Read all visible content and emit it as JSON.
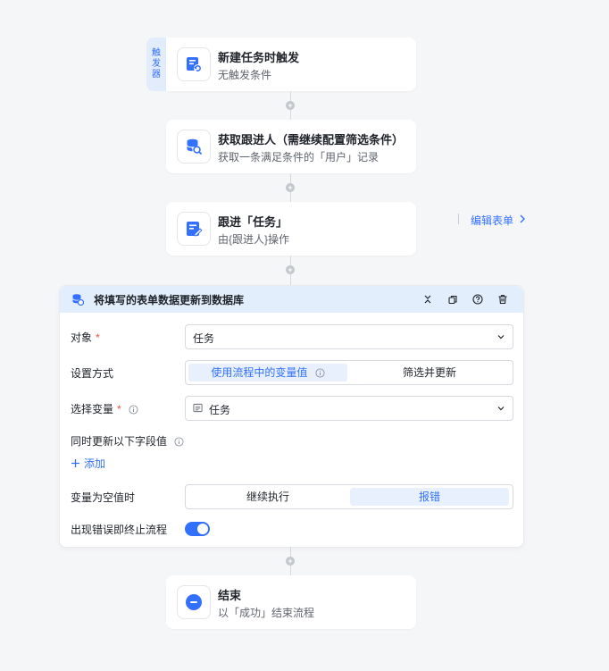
{
  "trigger_tab": [
    "触",
    "发",
    "器"
  ],
  "nodes": {
    "trigger": {
      "title": "新建任务时触发",
      "subtitle": "无触发条件"
    },
    "get_follower": {
      "title": "获取跟进人（需继续配置筛选条件）",
      "subtitle": "获取一条满足条件的「用户」记录"
    },
    "follow_task": {
      "title": "跟进「任务」",
      "subtitle": "由{跟进人}操作",
      "link": "编辑表单"
    },
    "end": {
      "title": "结束",
      "subtitle": "以「成功」结束流程"
    }
  },
  "panel": {
    "title": "将填写的表单数据更新到数据库",
    "header_icons": [
      "collapse-icon",
      "copy-icon",
      "help-icon",
      "delete-icon"
    ],
    "fields": {
      "object": {
        "label": "对象",
        "required": "*",
        "value": "任务"
      },
      "set_mode": {
        "label": "设置方式",
        "options": [
          "使用流程中的变量值",
          "筛选并更新"
        ],
        "selected": 0
      },
      "variable": {
        "label": "选择变量",
        "required": "*",
        "value": "任务"
      },
      "update_fields": {
        "label": "同时更新以下字段值",
        "add_label": "添加"
      },
      "empty_var": {
        "label": "变量为空值时",
        "options": [
          "继续执行",
          "报错"
        ],
        "selected": 1
      },
      "stop_on_error": {
        "label": "出现错误即终止流程",
        "on": true
      }
    }
  },
  "colors": {
    "accent": "#3370ff",
    "required": "#f54a45",
    "header_bg": "#e2eefc"
  }
}
